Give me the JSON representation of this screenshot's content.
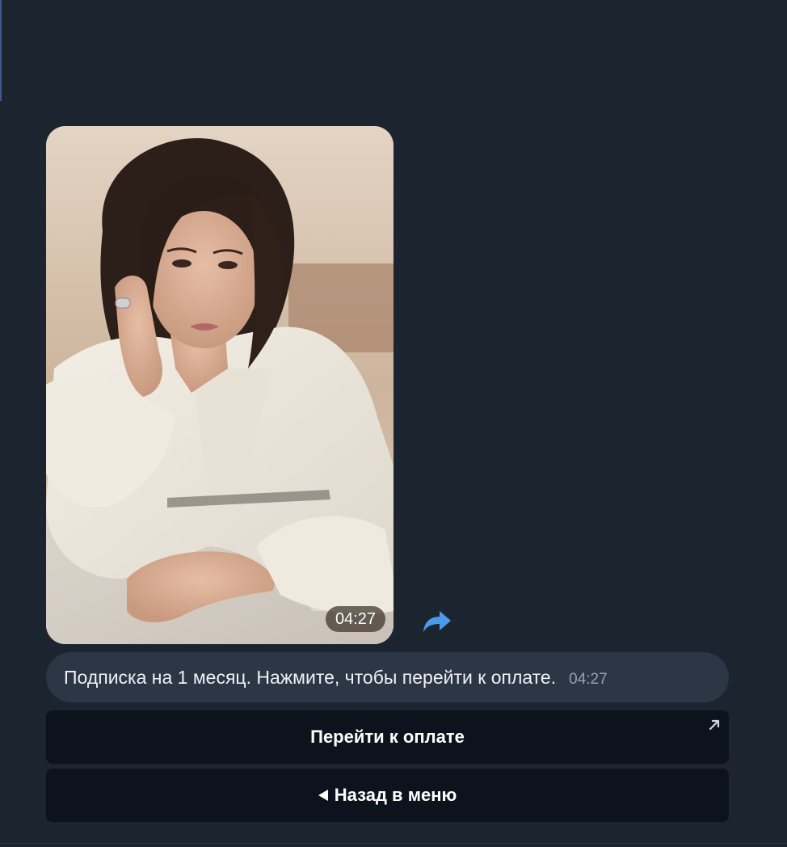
{
  "photo_message": {
    "time": "04:27"
  },
  "text_message": {
    "text": "Подписка на 1 месяц. Нажмите, чтобы перейти к оплате.",
    "time": "04:27"
  },
  "buttons": {
    "pay_label": "Перейти к оплате",
    "back_label": "Назад в меню"
  },
  "icons": {
    "share": "share-arrow-icon",
    "external_link": "arrow-up-right-icon",
    "back_triangle": "triangle-left-icon"
  },
  "colors": {
    "background": "#1c2430",
    "bubble": "#2c3644",
    "button": "#0c131d",
    "accent": "#4a9bee"
  }
}
